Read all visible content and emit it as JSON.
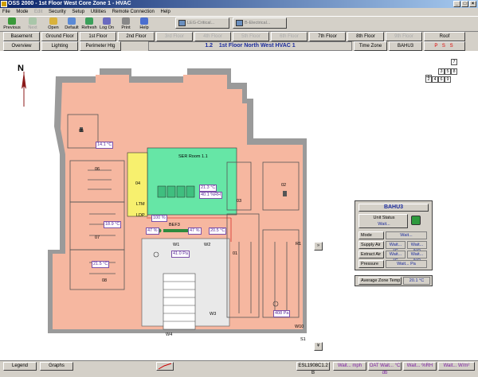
{
  "window": {
    "title": "OSS 2000 - 1st Floor West Core Zone 1 - HVAC"
  },
  "menu": [
    "File",
    "Mode",
    "Edit",
    "Security",
    "Setup",
    "Utilities",
    "Remote Connection",
    "Help"
  ],
  "toolbar": [
    {
      "label": "Previous",
      "icon": "arrow-left-icon"
    },
    {
      "label": "Next",
      "icon": "arrow-right-icon"
    },
    {
      "label": "Open",
      "icon": "folder-icon"
    },
    {
      "label": "Default",
      "icon": "home-icon"
    },
    {
      "label": "Refresh",
      "icon": "refresh-icon"
    },
    {
      "label": "Log On",
      "icon": "key-icon"
    },
    {
      "label": "Print",
      "icon": "printer-icon"
    },
    {
      "label": "Help",
      "icon": "help-icon"
    }
  ],
  "task_tabs": [
    "LEG-Critical...",
    "B-Electrical..."
  ],
  "floors": [
    "Basement",
    "Ground Floor",
    "1st Floor",
    "2nd Floor",
    "3rd Floor",
    "4th Floor",
    "5th Floor",
    "6th Floor",
    "7th Floor",
    "8th Floor",
    "9th Floor",
    "Roof"
  ],
  "nav_row2": {
    "overview": "Overview",
    "lighting": "Lighting",
    "perimeter": "Perimeter Htg",
    "location_code": "1.2",
    "location_title": "1st Floor North West HVAC 1",
    "time_zone": "Time Zone",
    "unit": "BAHU3",
    "pss": "P S S"
  },
  "compass": "N",
  "zone_keys": [
    "7",
    "3",
    "5",
    "8",
    "1",
    "2",
    "4",
    "6",
    "9"
  ],
  "rooms": {
    "r05": "05",
    "r06": "06",
    "r07": "07",
    "r08": "08",
    "r04": "04",
    "ltm": "LTM",
    "ldp": "LDP",
    "ser": "SER Room 1.1",
    "r02": "02",
    "r03": "03",
    "r01": "01",
    "bef3": "BEF3",
    "w1": "W1",
    "w2": "W2",
    "r1": "R1",
    "w3": "W3",
    "w4": "W4",
    "w10": "W10",
    "s1": "S1"
  },
  "readings": {
    "t05": "14.1 °C",
    "t07": "18.9 °C",
    "t08": "21.5 °C",
    "tser": "21.3 °C",
    "hser": "40.1 %RH",
    "p_ldp": "100 %",
    "t_bef1": "47 %",
    "t_bef2": "47 %",
    "t_bef3": "20.5 °C",
    "pa_w1": "41.0 Pa",
    "pa_r1": "408 Pa"
  },
  "ahu": {
    "title": "BAHU3",
    "unit_status_label": "Unit Status",
    "unit_status_value": "Wait...",
    "mode_label": "Mode",
    "mode_value": "Wait...",
    "supply_label": "Supply Air",
    "supply_t": "Wait... °C",
    "supply_h": "Wait... %R",
    "extract_label": "Extract Air",
    "extract_t": "Wait... °C",
    "extract_h": "Wait... %R",
    "pressure_label": "Pressure",
    "pressure_value": "Wait... Pa"
  },
  "avg_zone": {
    "label": "Average Zone Temp",
    "value": "20.1 °C"
  },
  "status": {
    "legend": "Legend",
    "graphs": "Graphs",
    "code": "ESL1908C1.2 B",
    "s1": "Wait... mph",
    "s2": "OAT Wait... °C db",
    "s3": "Wait... %RH",
    "s4": "Wait... W/m²"
  },
  "colors": {
    "accent": "#1b2b9c",
    "value_purple": "#7b1fa2",
    "zone_salmon": "#f6b7a0",
    "ser_green": "#66e6a6",
    "ltm_yellow": "#f7f06e"
  }
}
